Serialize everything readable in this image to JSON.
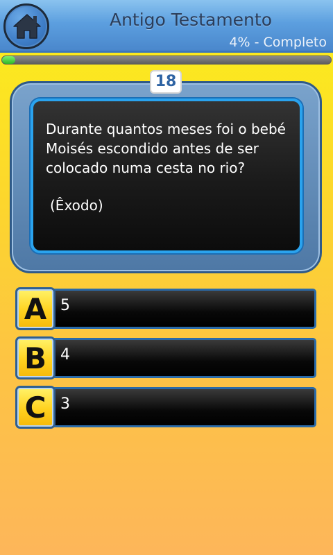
{
  "header": {
    "title": "Antigo Testamento",
    "progress_text": "4% - Completo",
    "home_icon": "home-icon"
  },
  "progress": {
    "percent": 4,
    "fill_color": "#3cc830"
  },
  "question": {
    "number": "18",
    "text": "Durante quantos meses foi o bebé Moisés escondido antes de ser colocado numa cesta no rio?",
    "reference": "(Êxodo)"
  },
  "answers": [
    {
      "letter": "A",
      "text": "5"
    },
    {
      "letter": "B",
      "text": "4"
    },
    {
      "letter": "C",
      "text": "3"
    }
  ],
  "colors": {
    "header_blue": "#5c9fdf",
    "accent_blue": "#2aa3ee",
    "answer_yellow": "#ffd21f",
    "background_yellow": "#fbf01a",
    "background_orange": "#fdb65a"
  }
}
